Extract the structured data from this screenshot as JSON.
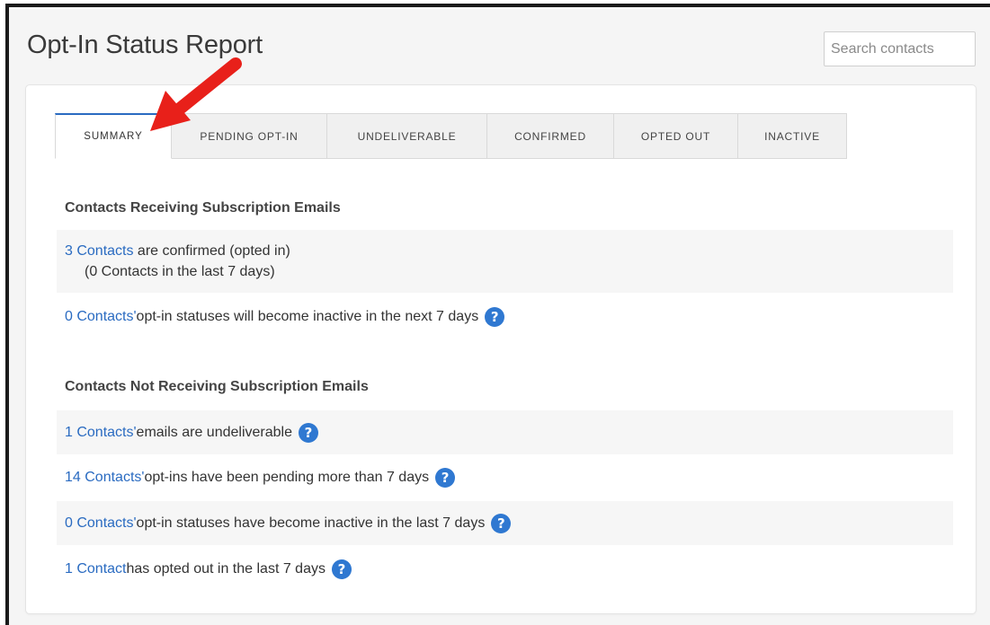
{
  "page": {
    "title": "Opt-In Status Report",
    "search_placeholder": "Search contacts"
  },
  "tabs": [
    {
      "label": "SUMMARY",
      "active": true
    },
    {
      "label": "PENDING OPT-IN",
      "active": false
    },
    {
      "label": "UNDELIVERABLE",
      "active": false
    },
    {
      "label": "CONFIRMED",
      "active": false
    },
    {
      "label": "OPTED OUT",
      "active": false
    },
    {
      "label": "INACTIVE",
      "active": false
    }
  ],
  "receiving": {
    "heading": "Contacts Receiving Subscription Emails",
    "confirmed": {
      "link": "3 Contacts",
      "text": " are confirmed (opted in)",
      "sub": "(0 Contacts in the last 7 days)"
    },
    "becoming_inactive": {
      "link": "0 Contacts'",
      "text": " opt-in statuses will become inactive in the next 7 days"
    }
  },
  "not_receiving": {
    "heading": "Contacts Not Receiving Subscription Emails",
    "undeliverable": {
      "link": "1 Contacts'",
      "text": " emails are undeliverable"
    },
    "pending": {
      "link": "14 Contacts'",
      "text": " opt-ins have been pending more than 7 days"
    },
    "inactive": {
      "link": "0 Contacts'",
      "text": " opt-in statuses have become inactive in the last 7 days"
    },
    "opted_out": {
      "link": "1 Contact",
      "text": " has opted out in the last 7 days"
    }
  },
  "help_icon_glyph": "?",
  "colors": {
    "link": "#2a6bc1",
    "help_icon": "#2f78d1",
    "annotation_arrow": "#e8201a",
    "active_tab_border": "#2a6bc1"
  },
  "icons": {
    "help": "question-circle-icon",
    "annotation": "red-arrow-annotation"
  }
}
